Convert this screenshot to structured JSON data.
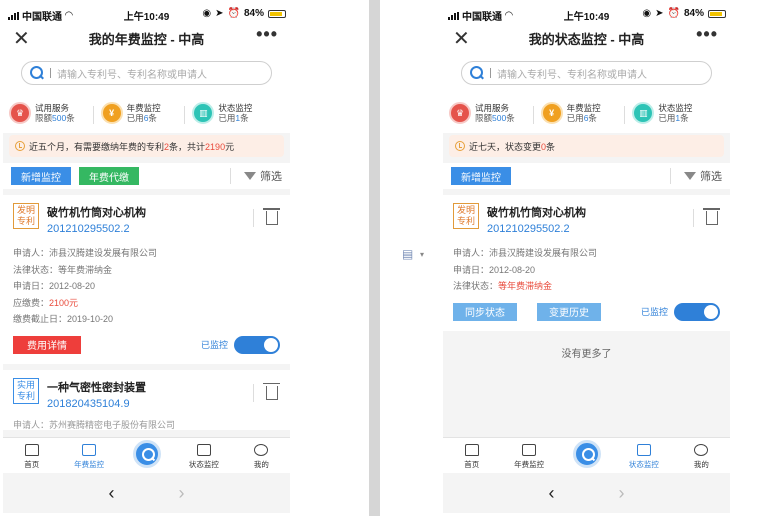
{
  "status_bar": {
    "carrier": "中国联通",
    "time": "上午10:49",
    "battery": "84%"
  },
  "left": {
    "title": "我的年费监控 - 中高",
    "search_placeholder": "请输入专利号、专利名称或申请人",
    "services": [
      {
        "name": "试用服务",
        "prefix": "限额",
        "num": "500",
        "suffix": "条",
        "icon": "vip-icon"
      },
      {
        "name": "年费监控",
        "prefix": "已用",
        "num": "6",
        "suffix": "条",
        "icon": "yen-icon"
      },
      {
        "name": "状态监控",
        "prefix": "已用",
        "num": "1",
        "suffix": "条",
        "icon": "chart-icon"
      }
    ],
    "notice": {
      "pre": "近五个月，有需要缴纳年费的专利",
      "count": "2",
      "mid": "条，共计",
      "amount": "2190",
      "post": "元"
    },
    "btn_add": "新增监控",
    "btn_pay": "年费代缴",
    "filter": "筛选",
    "card": {
      "tag_line1": "发明",
      "tag_line2": "专利",
      "title": "破竹机竹筒对心机构",
      "patent_no": "201210295502.2",
      "applicant_label": "申请人：",
      "applicant": "沛县汉腾建设发展有限公司",
      "legal_label": "法律状态：",
      "legal": "等年费滞纳金",
      "date_label": "申请日：",
      "date": "2012-08-20",
      "fee_label": "应缴费：",
      "fee": "2100元",
      "deadline_label": "缴费截止日：",
      "deadline": "2019-10-20",
      "btn_detail": "费用详情",
      "monitored": "已监控"
    },
    "card2": {
      "tag_line1": "实用",
      "tag_line2": "专利",
      "title": "一种气密性密封装置",
      "patent_no": "201820435104.9",
      "peek": "申请人：苏州赛腾精密电子股份有限公司"
    }
  },
  "right": {
    "title": "我的状态监控 - 中高",
    "search_placeholder": "请输入专利号、专利名称或申请人",
    "notice": {
      "pre": "近七天，状态变更",
      "count": "0",
      "post": "条"
    },
    "btn_add": "新增监控",
    "filter": "筛选",
    "card": {
      "tag_line1": "发明",
      "tag_line2": "专利",
      "title": "破竹机竹筒对心机构",
      "patent_no": "201210295502.2",
      "applicant_label": "申请人：",
      "applicant": "沛县汉腾建设发展有限公司",
      "date_label": "申请日：",
      "date": "2012-08-20",
      "legal_label": "法律状态：",
      "legal": "等年费滞纳金",
      "btn_sync": "同步状态",
      "btn_history": "变更历史",
      "monitored": "已监控"
    },
    "no_more": "没有更多了"
  },
  "tabs": [
    "首页",
    "年费监控",
    "状态监控",
    "我的"
  ]
}
